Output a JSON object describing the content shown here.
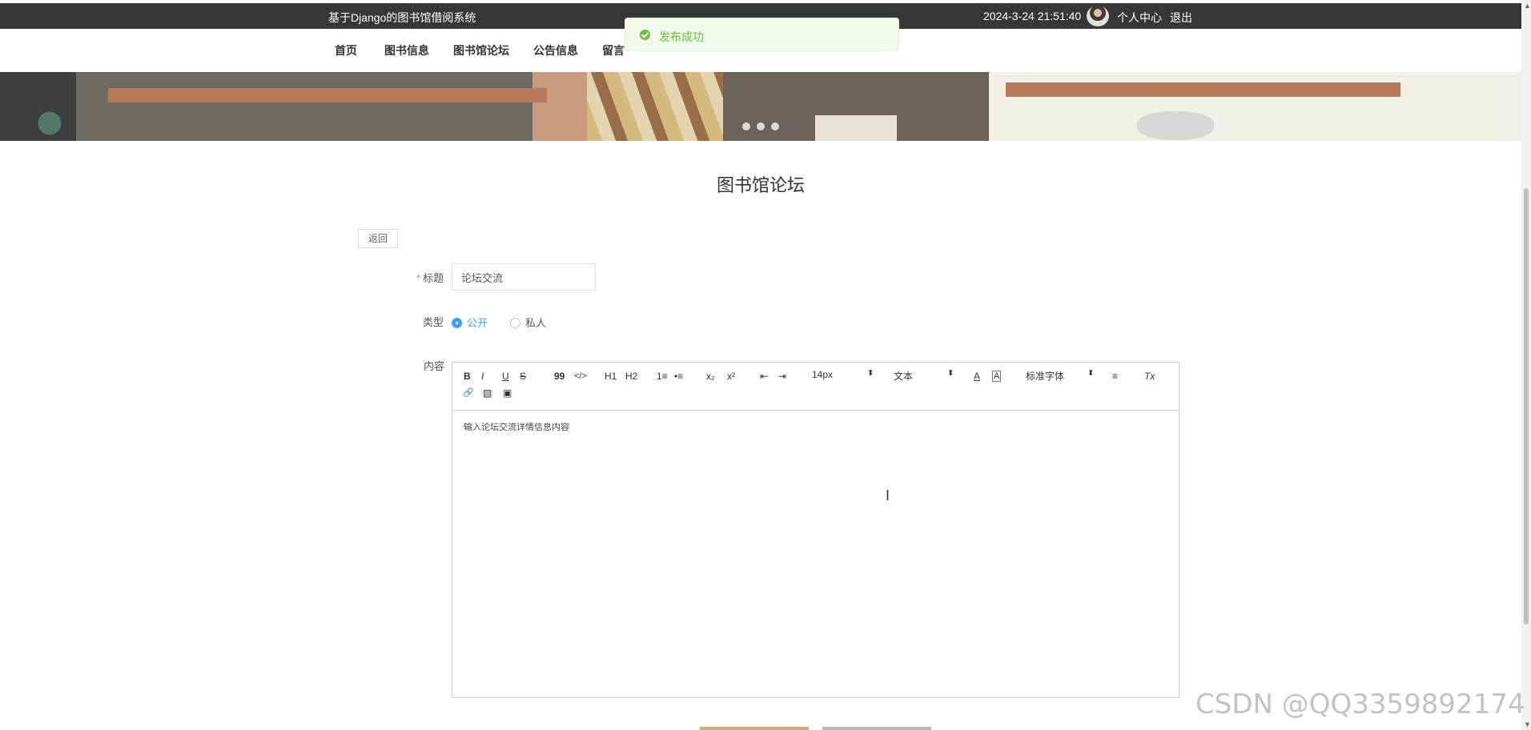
{
  "header": {
    "site_title": "基于Django的图书馆借阅系统",
    "datetime": "2024-3-24 21:51:40",
    "personal_center": "个人中心",
    "logout": "退出"
  },
  "nav": {
    "items": [
      {
        "label": "首页"
      },
      {
        "label": "图书信息"
      },
      {
        "label": "图书馆论坛"
      },
      {
        "label": "公告信息"
      },
      {
        "label": "留言"
      }
    ]
  },
  "toast": {
    "message": "发布成功",
    "icon": "success-check-icon",
    "color": "#67c23a"
  },
  "page": {
    "title": "图书馆论坛",
    "back_label": "返回"
  },
  "form": {
    "title_label": "标题",
    "title_value": "论坛交流",
    "type_label": "类型",
    "type_options": [
      {
        "label": "公开",
        "selected": true
      },
      {
        "label": "私人",
        "selected": false
      }
    ],
    "content_label": "内容",
    "editor_placeholder": "输入论坛交流详情信息内容",
    "font_size": "14px",
    "text_style": "文本",
    "font_family": "标准字体"
  },
  "editor_toolbar": {
    "icons": [
      {
        "name": "bold-icon",
        "label": "B"
      },
      {
        "name": "italic-icon",
        "label": "I"
      },
      {
        "name": "underline-icon",
        "label": "U"
      },
      {
        "name": "strike-icon",
        "label": "S"
      },
      {
        "name": "blockquote-icon",
        "label": "99"
      },
      {
        "name": "code-icon",
        "label": "</>"
      },
      {
        "name": "heading-1-icon",
        "label": "H1"
      },
      {
        "name": "heading-2-icon",
        "label": "H2"
      },
      {
        "name": "ordered-list-icon",
        "label": "1≡"
      },
      {
        "name": "bullet-list-icon",
        "label": "•≡"
      },
      {
        "name": "subscript-icon",
        "label": "x₂"
      },
      {
        "name": "superscript-icon",
        "label": "x²"
      },
      {
        "name": "indent-decrease-icon",
        "label": "⇤"
      },
      {
        "name": "indent-increase-icon",
        "label": "⇥"
      },
      {
        "name": "font-color-icon",
        "label": "A"
      },
      {
        "name": "background-color-icon",
        "label": "A"
      },
      {
        "name": "align-icon",
        "label": "≡"
      },
      {
        "name": "clear-format-icon",
        "label": "Tx"
      },
      {
        "name": "link-icon",
        "label": "🔗"
      },
      {
        "name": "image-icon",
        "label": "▧"
      },
      {
        "name": "video-icon",
        "label": "▣"
      }
    ]
  },
  "watermark": "CSDN @QQ3359892174",
  "scrollbar": {
    "up_glyph": "▲",
    "down_glyph": "▼"
  }
}
